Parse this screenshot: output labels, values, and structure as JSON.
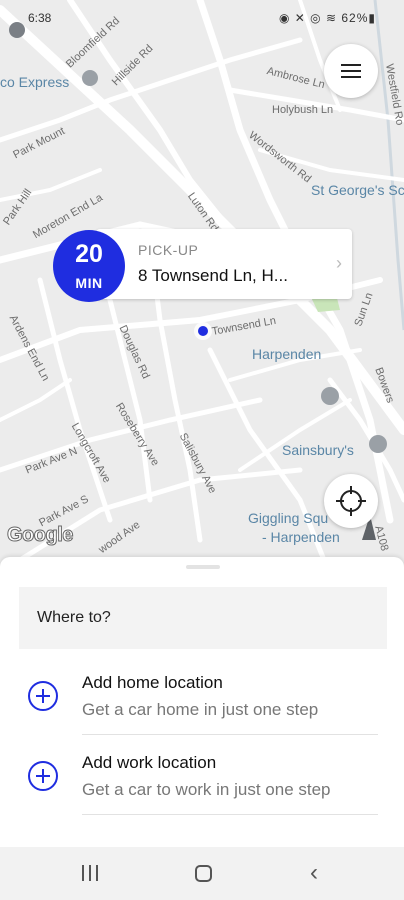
{
  "status_bar": {
    "time": "6:38",
    "icons_text": "◉ ✕ ◎ ≋ 62%▮"
  },
  "map": {
    "labels": {
      "bloomfield_rd": "Bloomfield Rd",
      "hillside_rd": "Hillside Rd",
      "ambrose_ln": "Ambrose Ln",
      "westfield_rd": "Westfield Ro",
      "express": "co Express",
      "holybush_ln": "Holybush Ln",
      "park_mount": "Park Mount",
      "wordsworth_rd": "Wordsworth Rd",
      "lyton_rd": "Luton Rd",
      "st_georges": "St George's Sc",
      "park_hill": "Park Hill",
      "moreton_end": "Moreton End La",
      "ardens_end": "Ardens End Ln",
      "douglas_rd": "Douglas Rd",
      "townsend_ln": "Townsend Ln",
      "sun_ln": "Sun Ln",
      "harpenden": "Harpenden",
      "bowers": "Bowers",
      "roseberry_ave": "Roseberry Ave",
      "longcroft_ave": "Longcroft Ave",
      "salisbury_ave": "Salisbury Ave",
      "park_ave_n": "Park Ave N",
      "sainsburys": "Sainsbury's",
      "park_ave_s": "Park Ave S",
      "giggling_squid": "Giggling Squ",
      "giggling_squid_2": "- Harpenden",
      "a1081": "A108",
      "wood_ave": "wood Ave"
    },
    "attribution": "Google"
  },
  "menu_button": {
    "icon": "hamburger-menu-icon"
  },
  "locate_button": {
    "icon": "crosshair-icon"
  },
  "pickup": {
    "eta_number": "20",
    "eta_unit": "MIN",
    "label": "PICK-UP",
    "address": "8 Townsend Ln, H..."
  },
  "sheet": {
    "search_placeholder": "Where to?",
    "items": [
      {
        "title": "Add home location",
        "subtitle": "Get a car home in just one step"
      },
      {
        "title": "Add work location",
        "subtitle": "Get a car to work in just one step"
      }
    ]
  },
  "colors": {
    "accent": "#1f2de0",
    "map_bg": "#ececec",
    "road": "#ffffff"
  }
}
